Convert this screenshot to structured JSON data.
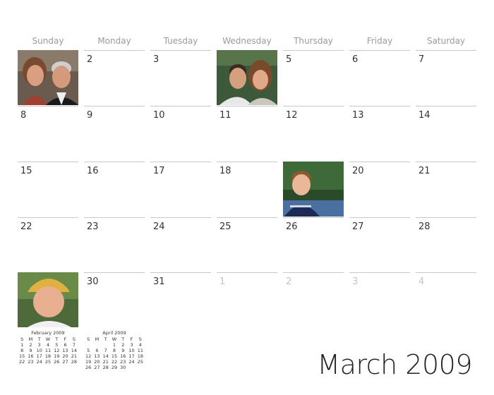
{
  "month_title": "March 2009",
  "weekdays": [
    "Sunday",
    "Monday",
    "Tuesday",
    "Wednesday",
    "Thursday",
    "Friday",
    "Saturday"
  ],
  "weeks": [
    [
      {
        "n": "",
        "photo": "couple-photo-1"
      },
      {
        "n": "2"
      },
      {
        "n": "3"
      },
      {
        "n": "",
        "photo": "couple-photo-2"
      },
      {
        "n": "5"
      },
      {
        "n": "6"
      },
      {
        "n": "7"
      }
    ],
    [
      {
        "n": "8"
      },
      {
        "n": "9"
      },
      {
        "n": "10"
      },
      {
        "n": "11"
      },
      {
        "n": "12"
      },
      {
        "n": "13"
      },
      {
        "n": "14"
      }
    ],
    [
      {
        "n": "15"
      },
      {
        "n": "16"
      },
      {
        "n": "17"
      },
      {
        "n": "18"
      },
      {
        "n": "",
        "photo": "child-photo"
      },
      {
        "n": "20"
      },
      {
        "n": "21"
      }
    ],
    [
      {
        "n": "22"
      },
      {
        "n": "23"
      },
      {
        "n": "24"
      },
      {
        "n": "25"
      },
      {
        "n": "26"
      },
      {
        "n": "27"
      },
      {
        "n": "28"
      }
    ],
    [
      {
        "n": "",
        "photo": "man-cap-photo"
      },
      {
        "n": "30"
      },
      {
        "n": "31"
      },
      {
        "n": "1",
        "dim": true
      },
      {
        "n": "2",
        "dim": true
      },
      {
        "n": "3",
        "dim": true
      },
      {
        "n": "4",
        "dim": true
      }
    ]
  ],
  "mini_feb": {
    "title": "February 2009",
    "head": [
      "S",
      "M",
      "T",
      "W",
      "T",
      "F",
      "S"
    ],
    "rows": [
      [
        "1",
        "2",
        "3",
        "4",
        "5",
        "6",
        "7"
      ],
      [
        "8",
        "9",
        "10",
        "11",
        "12",
        "13",
        "14"
      ],
      [
        "15",
        "16",
        "17",
        "18",
        "19",
        "20",
        "21"
      ],
      [
        "22",
        "23",
        "24",
        "25",
        "26",
        "27",
        "28"
      ]
    ]
  },
  "mini_apr": {
    "title": "April 2009",
    "head": [
      "S",
      "M",
      "T",
      "W",
      "T",
      "F",
      "S"
    ],
    "rows": [
      [
        "",
        "",
        "",
        "1",
        "2",
        "3",
        "4"
      ],
      [
        "5",
        "6",
        "7",
        "8",
        "9",
        "10",
        "11"
      ],
      [
        "12",
        "13",
        "14",
        "15",
        "16",
        "17",
        "18"
      ],
      [
        "19",
        "20",
        "21",
        "22",
        "23",
        "24",
        "25"
      ],
      [
        "26",
        "27",
        "28",
        "29",
        "30",
        "",
        ""
      ]
    ]
  }
}
